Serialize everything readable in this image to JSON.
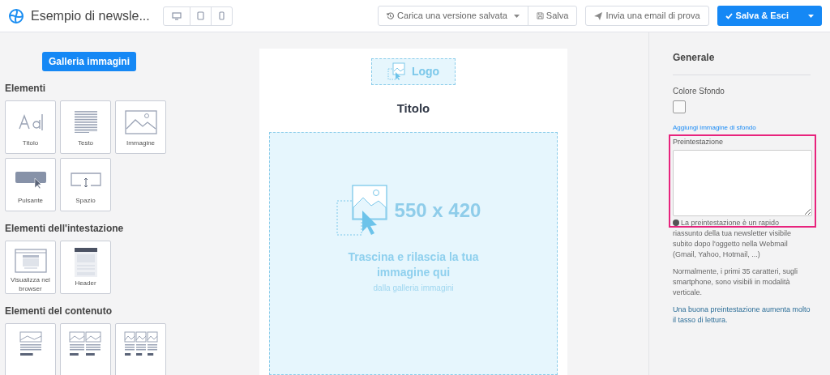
{
  "header": {
    "title": "Esempio di newsle...",
    "devices": [
      {
        "kind": "desktop"
      },
      {
        "kind": "tablet"
      },
      {
        "kind": "phone"
      }
    ],
    "load_version": "Carica una versione salvata",
    "save": "Salva",
    "send_test": "Invia una email di prova",
    "save_exit": "Salva & Esci"
  },
  "left_panel": {
    "gallery_button": "Galleria immagini",
    "sections": [
      {
        "title": "Elementi",
        "tiles": [
          {
            "kind": "title",
            "label": "Titolo"
          },
          {
            "kind": "text",
            "label": "Testo"
          },
          {
            "kind": "image",
            "label": "Immagine"
          },
          {
            "kind": "button",
            "label": "Pulsante"
          },
          {
            "kind": "spacer",
            "label": "Spazio"
          }
        ]
      },
      {
        "title": "Elementi dell'intestazione",
        "tiles": [
          {
            "kind": "browser",
            "label": "Visualizza nel browser"
          },
          {
            "kind": "header",
            "label": "Header"
          }
        ]
      },
      {
        "title": "Elementi del contenuto",
        "tiles": [
          {
            "kind": "block1"
          },
          {
            "kind": "block2"
          },
          {
            "kind": "block3"
          }
        ]
      }
    ]
  },
  "canvas": {
    "logo": "Logo",
    "title": "Titolo",
    "image_size": "550 x 420",
    "drop_text": "Trascina e rilascia la tua immagine qui",
    "drop_sub": "dalla galleria immagini"
  },
  "right_panel": {
    "heading": "Generale",
    "bg_color_label": "Colore Sfondo",
    "bg_image_link": "Aggiungi immagine di sfondo",
    "preheader_label": "Preintestazione",
    "info": "La preintestazione è un rapido riassunto della tua newsletter visibile subito dopo l'oggetto nella Webmail (Gmail, Yahoo, Hotmail, ...)",
    "note": "Normalmente, i primi 35 caratteri, sugli smartphone, sono visibili in modalità verticale.",
    "tip": "Una buona preintestazione aumenta molto il tasso di lettura."
  }
}
